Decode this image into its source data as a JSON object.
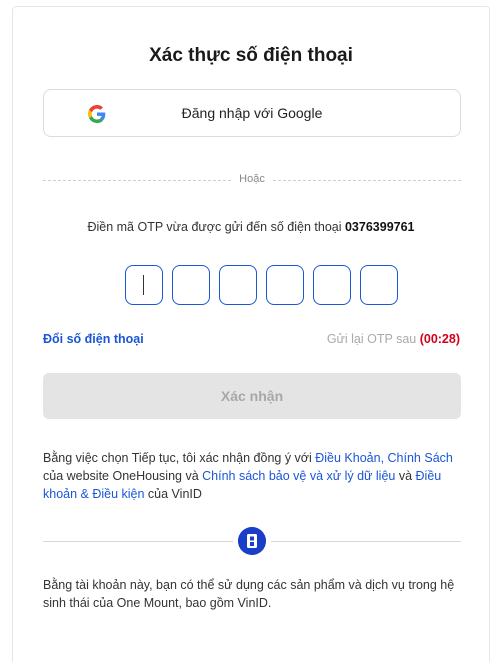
{
  "page": {
    "title": "Xác thực số điện thoại"
  },
  "google": {
    "icon": "google-g-icon",
    "label": "Đăng nhập với Google"
  },
  "divider": {
    "label": "Hoặc"
  },
  "otp": {
    "info_prefix": "Điền mã OTP vừa được gửi đến số điện thoại ",
    "phone": "0376399761",
    "digits": [
      "",
      "",
      "",
      "",
      "",
      ""
    ],
    "accent_color": "#1a56d6"
  },
  "actions": {
    "change_phone": "Đổi số điện thoại",
    "resend_prefix": "Gửi lại OTP sau ",
    "resend_timer": "(00:28)",
    "confirm": "Xác nhận"
  },
  "terms": {
    "t1": "Bằng việc chọn Tiếp tục, tôi xác nhận đồng ý với ",
    "link1": "Điều Khoản, Chính Sách",
    "t2": " của website OneHousing và ",
    "link2": "Chính sách bảo vệ và xử lý dữ liệu",
    "t3": " và ",
    "link3": "Điều khoản & Điều kiện",
    "t4": " của VinID"
  },
  "separator_logo": "one-mount-logo-icon",
  "footer": {
    "note": "Bằng tài khoản này, bạn có thể sử dụng các sản phẩm và dịch vụ trong hệ sinh thái của One Mount, bao gồm VinID."
  }
}
